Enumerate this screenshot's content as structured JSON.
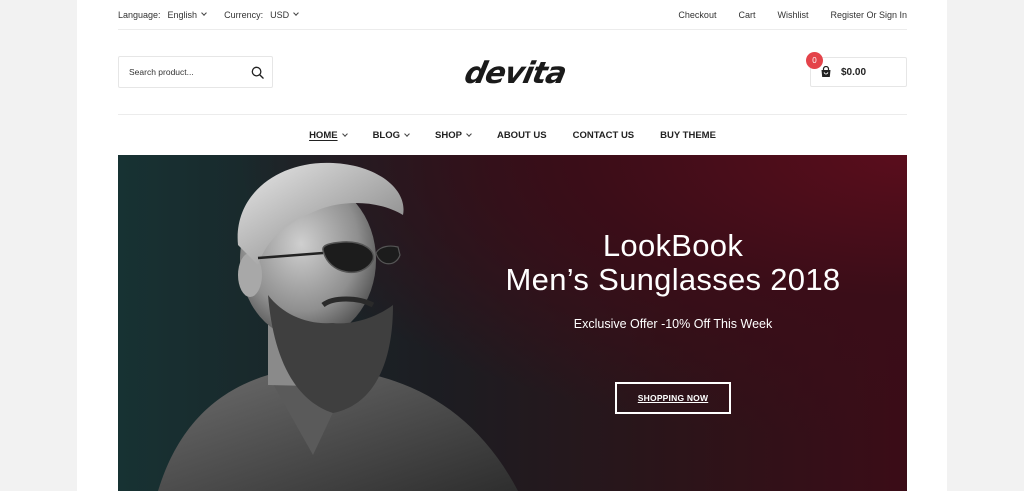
{
  "topbar": {
    "language_label": "Language:",
    "language_value": "English",
    "currency_label": "Currency:",
    "currency_value": "USD",
    "links": [
      "Checkout",
      "Cart",
      "Wishlist",
      "Register Or Sign In"
    ]
  },
  "header": {
    "search_placeholder": "Search product...",
    "logo_text": "devita",
    "cart_count": "0",
    "cart_total": "$0.00"
  },
  "nav": {
    "items": [
      {
        "label": "HOME",
        "has_dropdown": true,
        "active": true
      },
      {
        "label": "BLOG",
        "has_dropdown": true
      },
      {
        "label": "SHOP",
        "has_dropdown": true
      },
      {
        "label": "ABOUT US",
        "has_dropdown": false
      },
      {
        "label": "CONTACT US",
        "has_dropdown": false
      },
      {
        "label": "BUY THEME",
        "has_dropdown": false
      }
    ]
  },
  "hero": {
    "title_line1": "LookBook",
    "title_line2": "Men’s Sunglasses 2018",
    "subtitle": "Exclusive Offer -10% Off This Week",
    "button_label": "SHOPPING NOW"
  },
  "colors": {
    "badge": "#e4434a",
    "hero_left": "#173233",
    "hero_right": "#3b0c17"
  },
  "icons": [
    "chevron-down-icon",
    "search-icon",
    "shopping-bag-icon"
  ]
}
